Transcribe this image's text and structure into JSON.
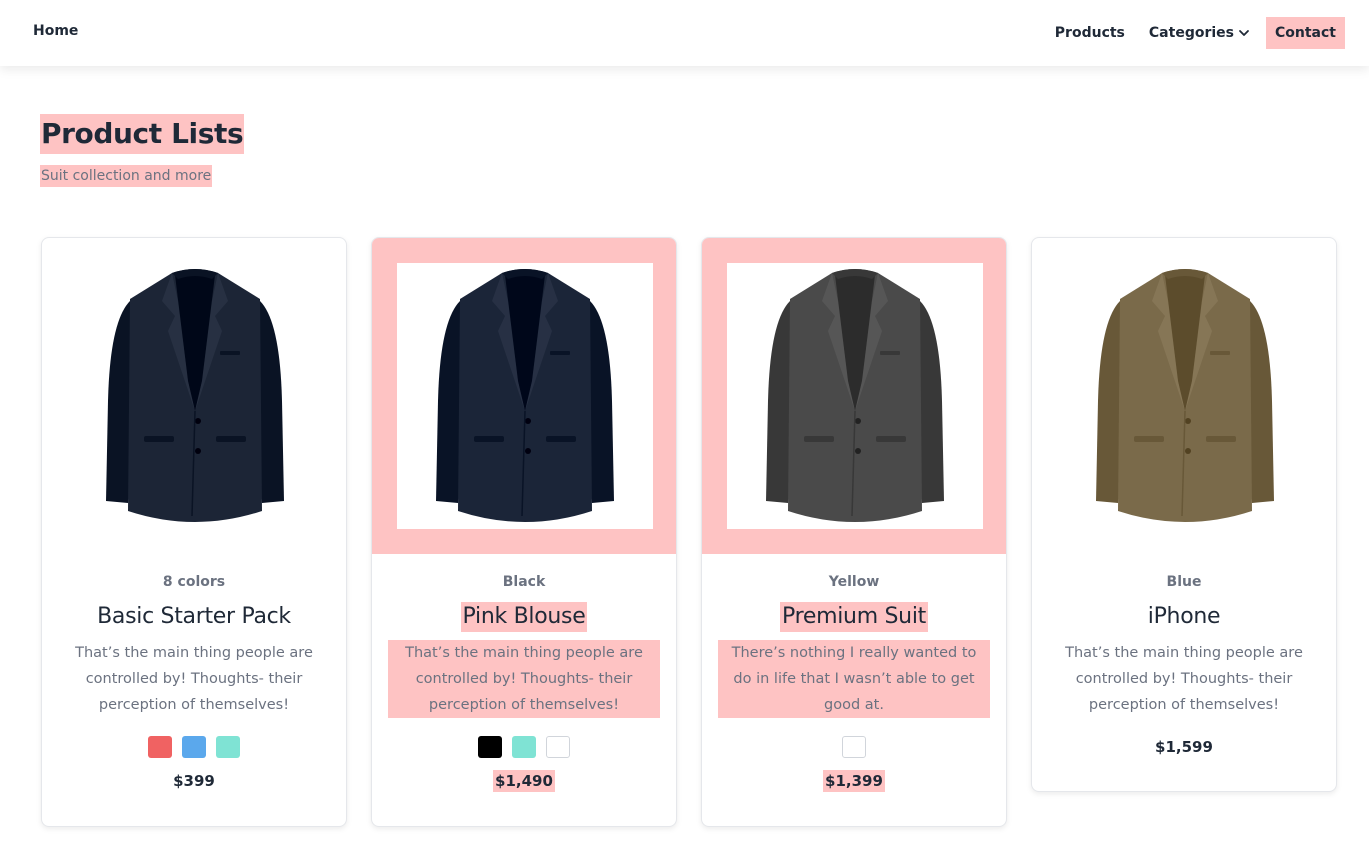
{
  "nav": {
    "home": "Home",
    "products": "Products",
    "categories": "Categories",
    "contact": "Contact"
  },
  "header": {
    "title": "Product Lists",
    "subtitle": "Suit collection and more"
  },
  "products": [
    {
      "color_label": "8 colors",
      "name": "Basic Starter Pack",
      "description": "That’s the main thing people are controlled by! Thoughts- their perception of themselves!",
      "swatches": [
        "#f06262",
        "#5ba8ec",
        "#7fe3d4"
      ],
      "price": "$399",
      "jacket_color": "#1c2536"
    },
    {
      "color_label": "Black",
      "name": "Pink Blouse",
      "description": "That’s the main thing people are controlled by! Thoughts- their perception of themselves!",
      "swatches": [
        "#000000",
        "#7fe3d4",
        "#ffffff"
      ],
      "price": "$1,490",
      "jacket_color": "#1b2538"
    },
    {
      "color_label": "Yellow",
      "name": "Premium Suit",
      "description": "There’s nothing I really wanted to do in life that I wasn’t able to get good at.",
      "swatches": [
        "#ffffff"
      ],
      "price": "$1,399",
      "jacket_color": "#4a4a4a"
    },
    {
      "color_label": "Blue",
      "name": "iPhone",
      "description": "That’s the main thing people are controlled by! Thoughts- their perception of themselves!",
      "swatches": [],
      "price": "$1,599",
      "jacket_color": "#7a6a4a"
    }
  ],
  "colors": {
    "highlight": "#fec3c3",
    "text_dark": "#1f2937",
    "text_muted": "#6b7280"
  },
  "icons": {
    "categories_dropdown": "chevron-down-icon"
  }
}
